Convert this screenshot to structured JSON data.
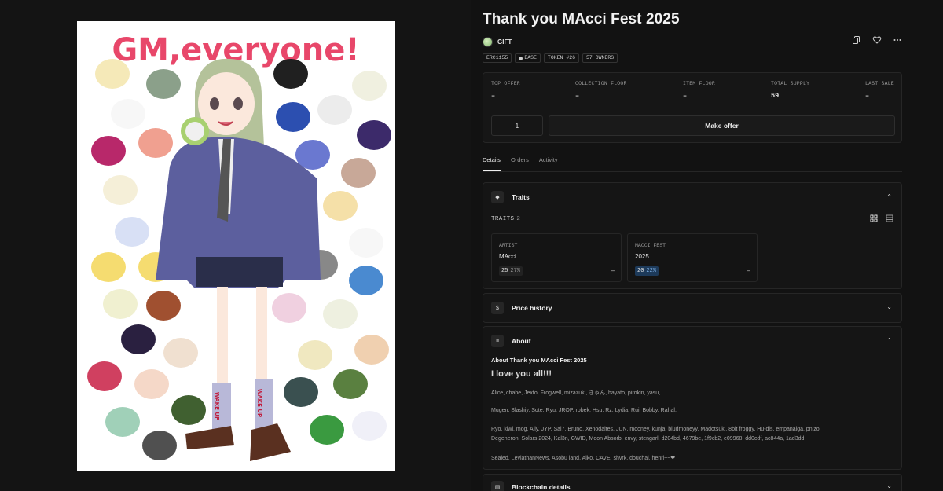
{
  "item": {
    "title": "Thank you MAcci Fest 2025",
    "collection": "GIFT",
    "chips": [
      "ERC1155",
      "BASE",
      "TOKEN #26",
      "57 OWNERS"
    ]
  },
  "artwork": {
    "headline": "GM,everyone!",
    "sock_text": "WAKE UP"
  },
  "stats": [
    {
      "label": "TOP OFFER",
      "value": "–"
    },
    {
      "label": "COLLECTION FLOOR",
      "value": "–"
    },
    {
      "label": "ITEM FLOOR",
      "value": "–"
    },
    {
      "label": "TOTAL SUPPLY",
      "value": "59"
    },
    {
      "label": "LAST SALE",
      "value": "–"
    }
  ],
  "offer": {
    "quantity": "1",
    "minus": "−",
    "plus": "+",
    "button_label": "Make offer"
  },
  "tabs": [
    "Details",
    "Orders",
    "Activity"
  ],
  "traits": {
    "title": "Traits",
    "count_label": "TRAITS",
    "count": "2",
    "items": [
      {
        "type": "ARTIST",
        "value": "MAcci",
        "count": "25",
        "pct": "27%",
        "dash": "–"
      },
      {
        "type": "MACCI FEST",
        "value": "2025",
        "count": "20",
        "pct": "22%",
        "dash": "–"
      }
    ]
  },
  "price_history": {
    "title": "Price history"
  },
  "about": {
    "title": "About",
    "subtitle": "About Thank you MAcci Fest 2025",
    "heading": "I love you all!!!",
    "lines": [
      "Alice, chabe, Jexto, Frogwell, mizazuki, きゃん, hayato, pirokin, yasu,",
      "Mugen, Slashiy, Sote, Ryu, JROP, robek, Hsu, Rz, Lydia, Rui, Bobby, Rahal,",
      "Ryo, kiwi, mog, Ally, JYP, Sai7, Bruno, Xenodaites, JUN, mooney, kunja,  bludmoneyy, Madotsuki, 8bit froggy, Hu-dis, empanaiga, pnizo,",
      "Degeneron, Solars 2024, Kal3n, GWID, Moon Absorb, envy, stengarl, d204bd, 4679be, 1f9cb2, e09968, dd0cdf, ac844a, 1ad3dd,",
      "Sealed, LeviathanNews,  Asobu land, Aiko, CAVE, shvrk, douchai, henri~~❤"
    ]
  },
  "blockchain": {
    "title": "Blockchain details"
  },
  "icons": {
    "copy": "copy-icon",
    "favorite": "heart-icon",
    "more": "more-icon",
    "traits": "diamond-icon",
    "price": "dollar-icon",
    "about": "text-icon",
    "blockchain": "chain-icon"
  },
  "colors": {
    "background": "#121212",
    "headline_pink": "#e8476a",
    "highlight_blue": "#1d3a5a"
  }
}
